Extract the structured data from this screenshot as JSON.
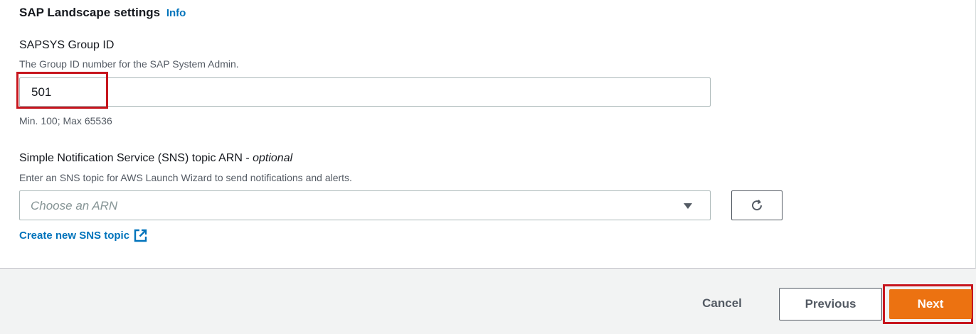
{
  "section": {
    "title": "SAP Landscape settings",
    "info_label": "Info"
  },
  "sapsys_group": {
    "label": "SAPSYS Group ID",
    "description": "The Group ID number for the SAP System Admin.",
    "value": "501",
    "constraint": "Min. 100; Max 65536"
  },
  "sns": {
    "label": "Simple Notification Service (SNS) topic ARN",
    "label_sep": " - ",
    "optional": "optional",
    "description": "Enter an SNS topic for AWS Launch Wizard to send notifications and alerts.",
    "placeholder": "Choose an ARN",
    "create_link": "Create new SNS topic"
  },
  "footer": {
    "cancel": "Cancel",
    "previous": "Previous",
    "next": "Next"
  },
  "colors": {
    "accent": "#ec7211",
    "link": "#0073bb",
    "highlight": "#c7161e"
  },
  "icons": {
    "select_caret": "caret-down-icon",
    "refresh": "refresh-icon",
    "external_link": "external-link-icon"
  }
}
